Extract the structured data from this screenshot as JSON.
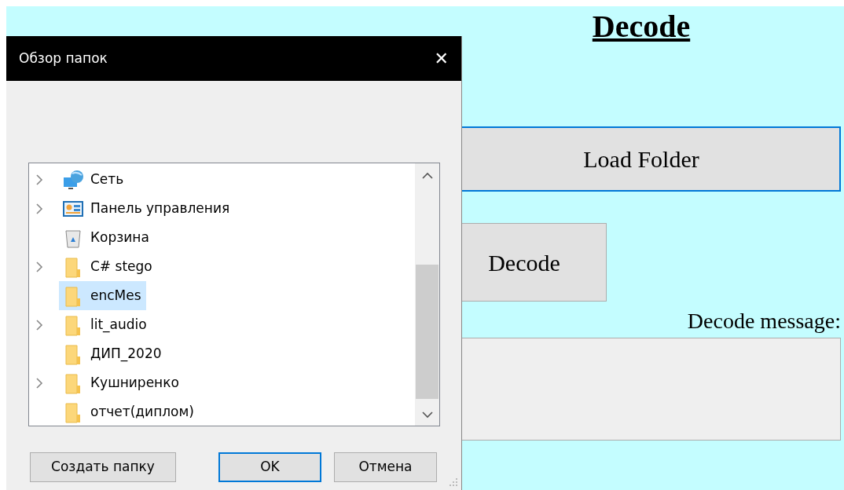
{
  "app": {
    "heading": "Decode",
    "load_button": {
      "label": "Load Folder",
      "focused": true
    },
    "decode_button": {
      "label": "Decode"
    },
    "message_label": "Decode message:"
  },
  "dialog": {
    "title": "Обзор папок",
    "close": "✕",
    "tree": [
      {
        "kind": "network",
        "label": "Сеть",
        "expandable": true,
        "selected": false
      },
      {
        "kind": "control-panel",
        "label": "Панель управления",
        "expandable": true,
        "selected": false
      },
      {
        "kind": "recycle-bin",
        "label": "Корзина",
        "expandable": false,
        "selected": false
      },
      {
        "kind": "folder",
        "label": "C# stego",
        "expandable": true,
        "selected": false
      },
      {
        "kind": "folder",
        "label": "encMes",
        "expandable": false,
        "selected": true
      },
      {
        "kind": "folder",
        "label": "lit_audio",
        "expandable": true,
        "selected": false
      },
      {
        "kind": "folder",
        "label": "ДИП_2020",
        "expandable": false,
        "selected": false
      },
      {
        "kind": "folder",
        "label": "Кушниренко",
        "expandable": true,
        "selected": false
      },
      {
        "kind": "folder",
        "label": "отчет(диплом)",
        "expandable": false,
        "selected": false
      }
    ],
    "buttons": [
      {
        "label": "Создать папку",
        "default": false
      },
      {
        "label": "OK",
        "default": true
      },
      {
        "label": "Отмена",
        "default": false
      }
    ]
  }
}
